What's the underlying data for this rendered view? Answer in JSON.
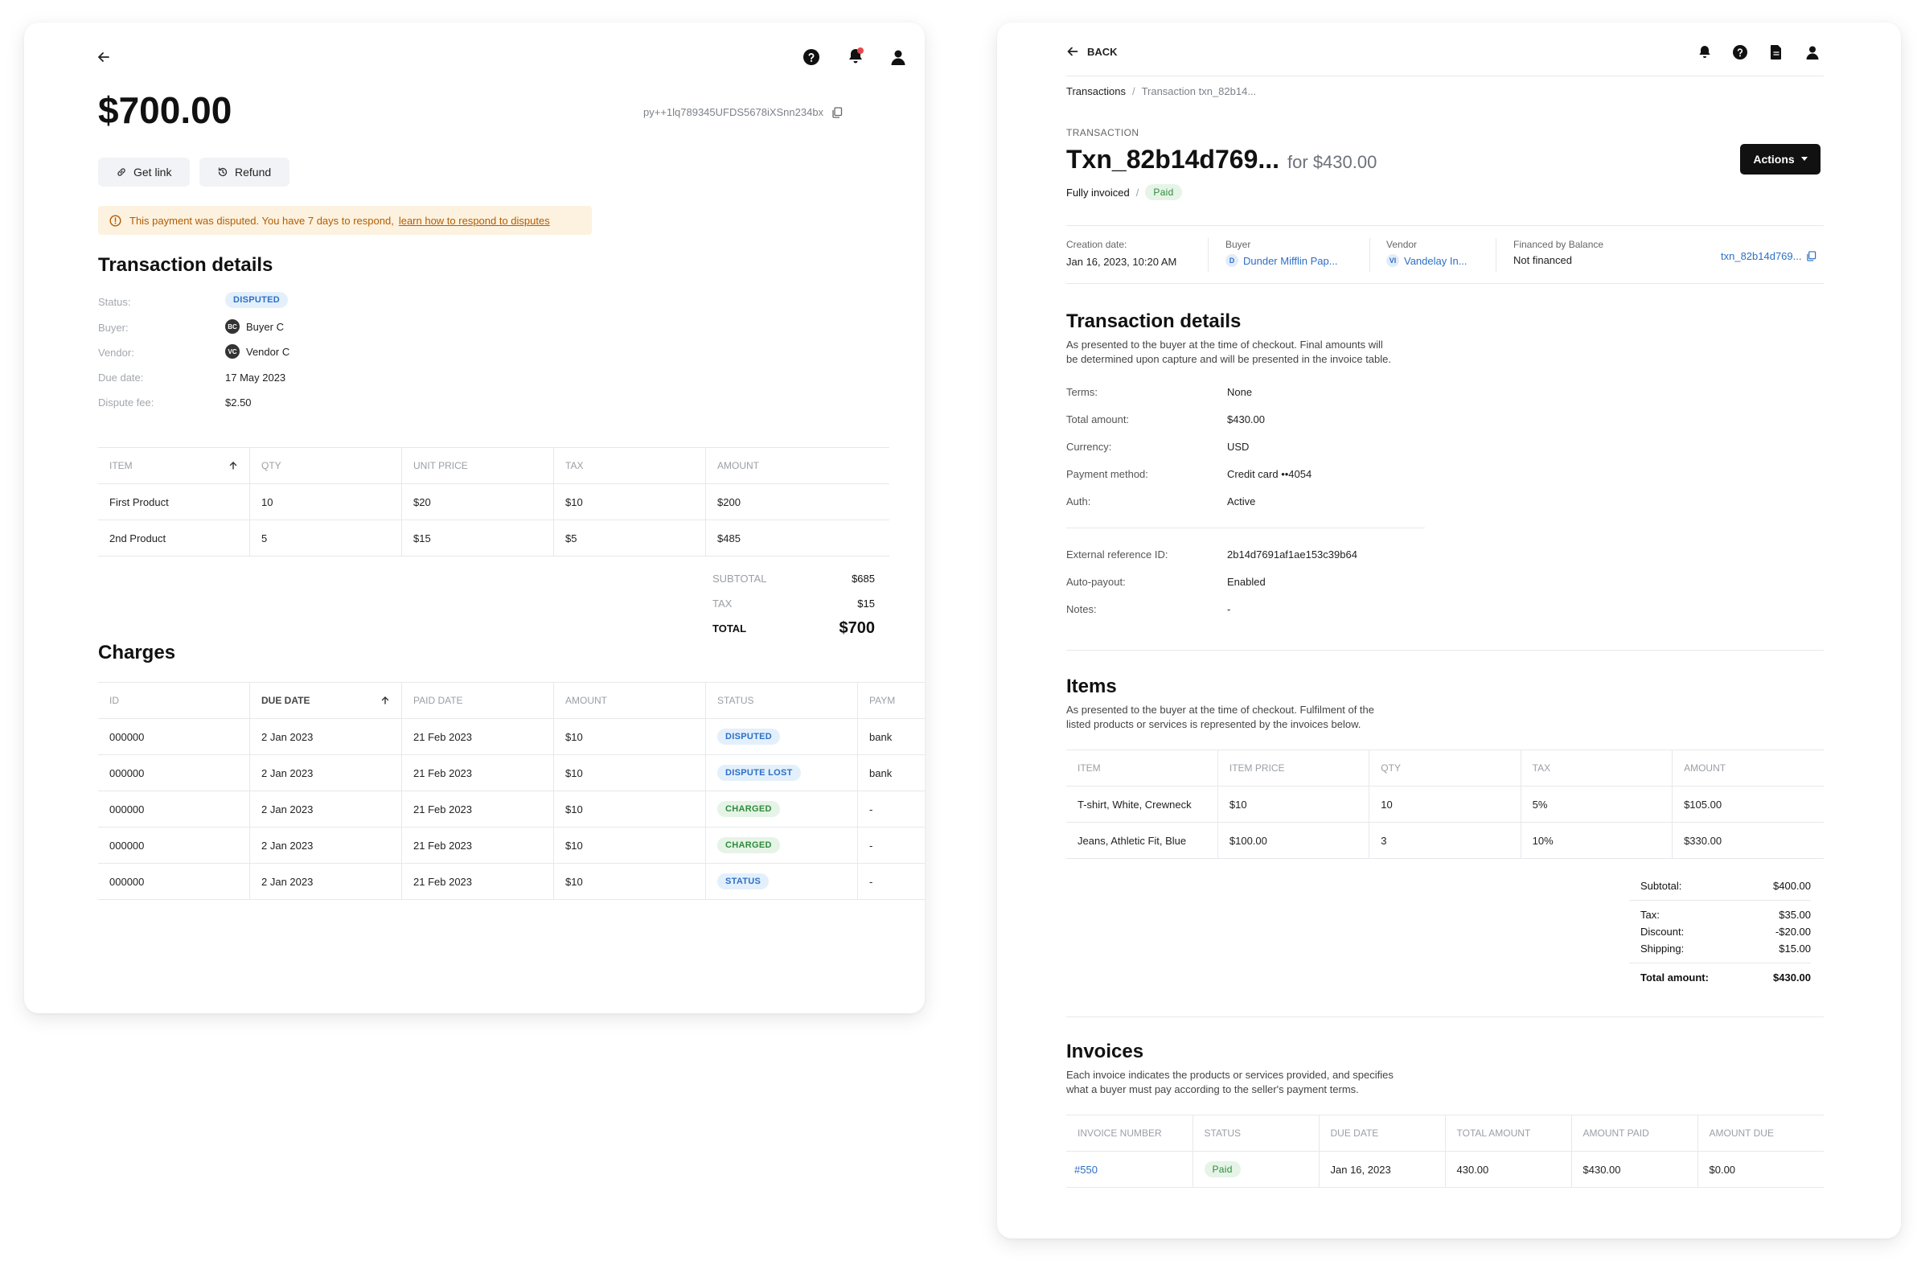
{
  "left": {
    "amount": "$700.00",
    "payment_id": "py++1lq789345UFDS5678iXSnn234bx",
    "buttons": {
      "get_link": "Get link",
      "refund": "Refund"
    },
    "banner": {
      "text": "This payment was disputed. You have 7 days to respond,",
      "link": "learn how to respond to disputes"
    },
    "details_title": "Transaction details",
    "details": {
      "status_label": "Status:",
      "status_value": "DISPUTED",
      "buyer_label": "Buyer:",
      "buyer_initials": "BC",
      "buyer_value": "Buyer C",
      "vendor_label": "Vendor:",
      "vendor_initials": "VC",
      "vendor_value": "Vendor C",
      "due_label": "Due date:",
      "due_value": "17 May 2023",
      "fee_label": "Dispute fee:",
      "fee_value": "$2.50"
    },
    "items_table": {
      "headers": [
        "ITEM",
        "QTY",
        "UNIT PRICE",
        "TAX",
        "AMOUNT"
      ],
      "rows": [
        [
          "First Product",
          "10",
          "$20",
          "$10",
          "$200"
        ],
        [
          "2nd Product",
          "5",
          "$15",
          "$5",
          "$485"
        ]
      ]
    },
    "totals": {
      "subtotal_label": "SUBTOTAL",
      "subtotal": "$685",
      "tax_label": "TAX",
      "tax": "$15",
      "total_label": "TOTAL",
      "total": "$700"
    },
    "charges_title": "Charges",
    "charges_table": {
      "headers": [
        "ID",
        "DUE DATE",
        "PAID DATE",
        "AMOUNT",
        "STATUS",
        "PAYM"
      ],
      "rows": [
        {
          "id": "000000",
          "due": "2 Jan 2023",
          "paid": "21 Feb 2023",
          "amount": "$10",
          "status": "DISPUTED",
          "pay": "bank"
        },
        {
          "id": "000000",
          "due": "2 Jan 2023",
          "paid": "21 Feb 2023",
          "amount": "$10",
          "status": "DISPUTE LOST",
          "pay": "bank"
        },
        {
          "id": "000000",
          "due": "2 Jan 2023",
          "paid": "21 Feb 2023",
          "amount": "$10",
          "status": "CHARGED",
          "pay": "-"
        },
        {
          "id": "000000",
          "due": "2 Jan 2023",
          "paid": "21 Feb 2023",
          "amount": "$10",
          "status": "CHARGED",
          "pay": "-"
        },
        {
          "id": "000000",
          "due": "2 Jan 2023",
          "paid": "21 Feb 2023",
          "amount": "$10",
          "status": "STATUS",
          "pay": "-"
        }
      ]
    }
  },
  "right": {
    "back_label": "BACK",
    "breadcrumb": {
      "root": "Transactions",
      "sep": "/",
      "current": "Transaction txn_82b14..."
    },
    "eyebrow": "TRANSACTION",
    "title": "Txn_82b14d769...",
    "title_suffix": "for $430.00",
    "invoiced": "Fully invoiced",
    "paid_badge": "Paid",
    "actions_label": "Actions",
    "meta": {
      "creation_label": "Creation date:",
      "creation_value": "Jan 16, 2023, 10:20 AM",
      "buyer_label": "Buyer",
      "buyer_initial": "D",
      "buyer_value": "Dunder Mifflin Pap...",
      "vendor_label": "Vendor",
      "vendor_initial": "VI",
      "vendor_value": "Vandelay In...",
      "financed_label": "Financed by Balance",
      "financed_value": "Not financed",
      "txn_link": "txn_82b14d769..."
    },
    "details_title": "Transaction details",
    "details_desc1": "As presented to the buyer at the time of checkout. Final amounts will",
    "details_desc2": "be determined upon capture and will be presented in the invoice table.",
    "details": [
      {
        "label": "Terms:",
        "value": "None"
      },
      {
        "label": "Total amount:",
        "value": "$430.00"
      },
      {
        "label": "Currency:",
        "value": "USD"
      },
      {
        "label": "Payment method:",
        "value": "Credit card ••4054"
      },
      {
        "label": "Auth:",
        "value": "Active"
      }
    ],
    "details2": [
      {
        "label": "External reference ID:",
        "value": "2b14d7691af1ae153c39b64"
      },
      {
        "label": "Auto-payout:",
        "value": "Enabled"
      },
      {
        "label": "Notes:",
        "value": "-"
      }
    ],
    "items_title": "Items",
    "items_desc1": "As presented to the buyer at the time of checkout. Fulfilment of the",
    "items_desc2": "listed products or services is represented by the invoices below.",
    "items_table": {
      "headers": [
        "ITEM",
        "ITEM PRICE",
        "QTY",
        "TAX",
        "AMOUNT"
      ],
      "rows": [
        [
          "T-shirt, White, Crewneck",
          "$10",
          "10",
          "5%",
          "$105.00"
        ],
        [
          "Jeans, Athletic Fit, Blue",
          "$100.00",
          "3",
          "10%",
          "$330.00"
        ]
      ]
    },
    "summary": {
      "subtotal_label": "Subtotal:",
      "subtotal": "$400.00",
      "tax_label": "Tax:",
      "tax": "$35.00",
      "discount_label": "Discount:",
      "discount": "-$20.00",
      "shipping_label": "Shipping:",
      "shipping": "$15.00",
      "total_label": "Total amount:",
      "total": "$430.00"
    },
    "invoices_title": "Invoices",
    "invoices_desc1": "Each invoice indicates the products or services provided, and specifies",
    "invoices_desc2": "what a buyer must pay according to the seller's payment terms.",
    "invoices_table": {
      "headers": [
        "INVOICE NUMBER",
        "STATUS",
        "DUE DATE",
        "TOTAL AMOUNT",
        "AMOUNT PAID",
        "AMOUNT DUE"
      ],
      "row": {
        "number": "#550",
        "status": "Paid",
        "due": "Jan 16, 2023",
        "total": "430.00",
        "paid": "$430.00",
        "due_amt": "$0.00"
      }
    }
  },
  "colors": {
    "accent_blue": "#2c6fc6",
    "badge_blue_bg": "#e3f0fc",
    "badge_green_bg": "#e5f4e6",
    "warning_bg": "#fdf2df",
    "warning_text": "#b35c00",
    "notification_dot": "#e5484d"
  }
}
